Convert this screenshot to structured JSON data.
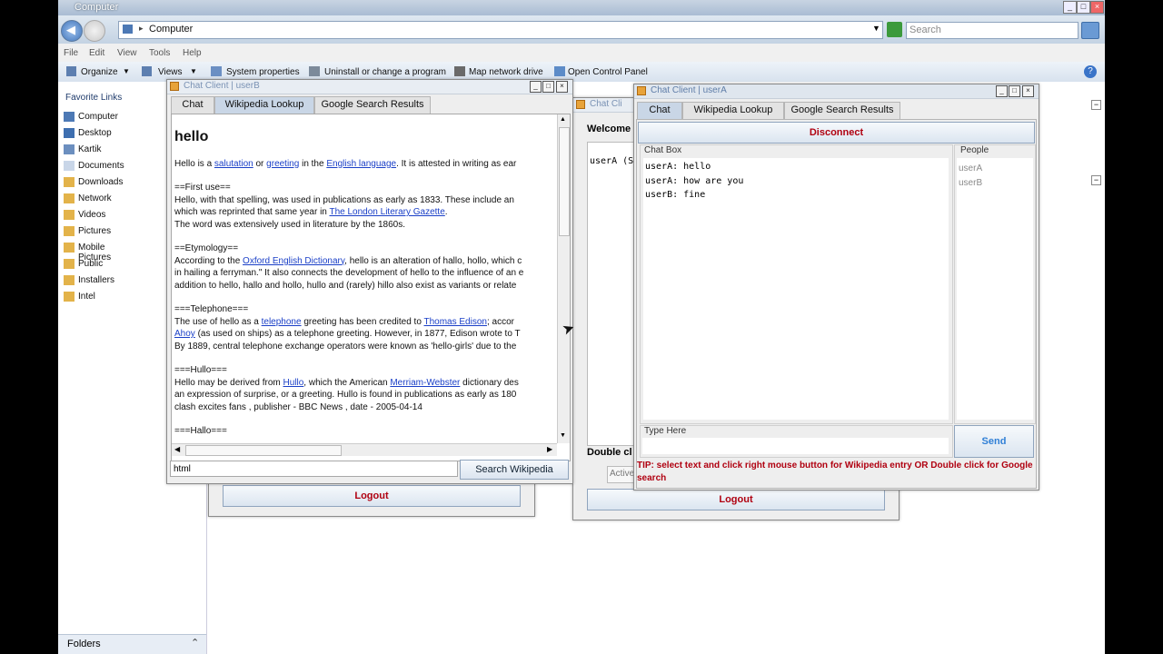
{
  "explorer": {
    "title": "Computer",
    "address": "Computer",
    "search_placeholder": "Search",
    "menu": [
      "File",
      "Edit",
      "View",
      "Tools",
      "Help"
    ],
    "toolbar": [
      "Organize",
      "Views",
      "System properties",
      "Uninstall or change a program",
      "Map network drive",
      "Open Control Panel"
    ],
    "favorite_links_label": "Favorite Links",
    "nav_items": [
      "Computer",
      "Desktop",
      "Kartik",
      "Documents",
      "Downloads",
      "Network",
      "Videos",
      "Pictures",
      "Mobile Pictures",
      "Public",
      "Installers",
      "Intel"
    ],
    "folders_label": "Folders"
  },
  "window_userB": {
    "title": "Chat Client | userB",
    "tabs": [
      "Chat",
      "Wikipedia Lookup",
      "Google Search Results"
    ],
    "heading": "hello",
    "p1": {
      "a": "Hello is a ",
      "l1": "salutation",
      "b": " or ",
      "l2": "greeting",
      "c": " in the ",
      "l3": "English language",
      "d": ". It is attested in writing as ear"
    },
    "first_use": {
      "h": "==First use==",
      "l1": "Hello, with that spelling, was used in publications as early as 1833. These include an",
      "l2a": "which was reprinted that same year in ",
      "l2link": "The London Literary Gazette",
      "l2b": ".",
      "l3": "The word was extensively used in literature by the 1860s."
    },
    "etymology": {
      "h": "==Etymology==",
      "l1a": "According to the ",
      "l1link": "Oxford English Dictionary",
      "l1b": ", hello is an alteration of hallo, hollo, which c",
      "l2": "in hailing a ferryman.\" It also connects the development of hello to the influence of an e",
      "l3": "addition to hello, hallo and hollo, hullo and (rarely) hillo also exist as variants or relate"
    },
    "telephone": {
      "h": "===Telephone===",
      "l1a": "The use of hello as a ",
      "l1link1": "telephone",
      "l1b": " greeting has been credited to ",
      "l1link2": "Thomas Edison",
      "l1c": "; accor",
      "l2link": "Ahoy",
      "l2b": " (as used on ships) as a telephone greeting. However, in 1877, Edison wrote to T",
      "l3": "By 1889, central telephone exchange operators were known as 'hello-girls' due to the"
    },
    "hullo": {
      "h": "===Hullo===",
      "l1a": "Hello may be derived from ",
      "l1link1": "Hullo",
      "l1b": ", which the American ",
      "l1link2": "Merriam-Webster",
      "l1c": " dictionary des",
      "l2": "an expression of surprise, or a greeting. Hullo is found in publications as early as 180",
      "l3": "clash excites fans , publisher - BBC News , date - 2005-04-14"
    },
    "hallo_partial": "===Hallo===",
    "search_value": "html",
    "search_button": "Search Wikipedia",
    "logout": "Logout"
  },
  "window_middle": {
    "title": "Chat Cli",
    "welcome": "Welcome",
    "user_line": "userA (S",
    "double_click": "Double cl",
    "active": "Active",
    "logout": "Logout"
  },
  "window_userA": {
    "title": "Chat Client | userA",
    "tabs": [
      "Chat",
      "Wikipedia Lookup",
      "Google Search Results"
    ],
    "disconnect": "Disconnect",
    "chat_box_label": "Chat Box",
    "people_label": "People",
    "messages": [
      "userA: hello",
      "userA: how are you",
      "userB: fine"
    ],
    "people": [
      "userA",
      "userB"
    ],
    "type_here_label": "Type Here",
    "send": "Send",
    "tip": "TIP: select text and click right mouse button for Wikipedia entry OR Double click for Google search",
    "logout": "Logout"
  },
  "colors": {
    "accent_red": "#b00010",
    "link": "#1a3fc7",
    "send_blue": "#2f7fd6"
  }
}
